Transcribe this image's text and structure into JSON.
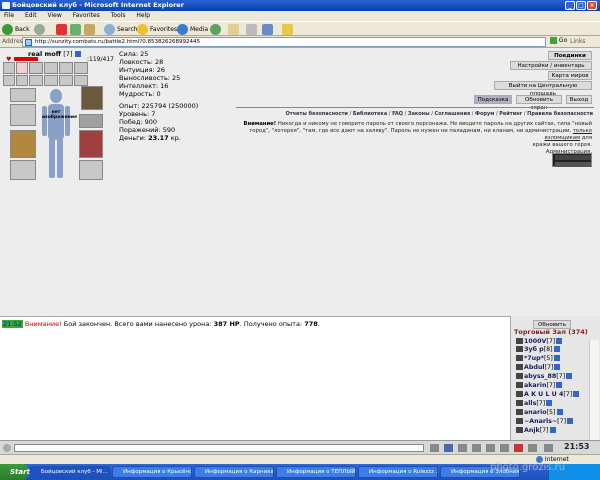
{
  "window": {
    "title": "Бойцовский клуб - Microsoft Internet Explorer"
  },
  "menu": [
    "File",
    "Edit",
    "View",
    "Favorites",
    "Tools",
    "Help"
  ],
  "toolbar": {
    "back": "Back",
    "search": "Search",
    "favorites": "Favorites",
    "media": "Media"
  },
  "address": {
    "label": "Address",
    "url": "http://sunzity.combats.ru/battle2.html?0.853826268992445",
    "go": "Go",
    "links": "Links"
  },
  "character": {
    "name": "real moff",
    "level": "[7]",
    "hp": ":119/417"
  },
  "stats": {
    "strength": "Сила: 25",
    "agility": "Ловкость: 28",
    "intuition": "Интуиция: 26",
    "endurance": "Выносливость: 25",
    "intellect": "Интеллект: 16",
    "wisdom": "Мудрость: 0"
  },
  "stats2": {
    "exp": "Опыт: 225794 (250000)",
    "level": "Уровень: 7",
    "wins": "Побед: 900",
    "losses": "Поражений: 590",
    "money_label": "Деньги:",
    "money_value": "23.17",
    "money_unit": "кр."
  },
  "slot_label": "нет изображения",
  "buttons": {
    "victory": "Поединки",
    "settings": "Настройки / инвентарь",
    "map": "Карта миров",
    "exit": "Выйти на Центральную площадь",
    "hint": "Подсказка",
    "refresh_screen": "Обновить экран",
    "logout": "Выход"
  },
  "navlinks": [
    "Отчеты безопасности",
    "Библиотека",
    "FAQ",
    "Законы",
    "Соглашения",
    "Форум",
    "Рейтинг",
    "Правила безопасности"
  ],
  "warning": {
    "lead": "Внимание!",
    "text1": "Никогда и никому не говорите пароль от своего персонажа. Не вводите пароль на других сайтах, типа \"новый город\",",
    "text2": "\"лотерея\", \"там, где все дают на халяву\". Пароль не нужен ни паладинам, ни кланам, ни администрации,",
    "link": "только взломщикам",
    "text3": "для",
    "text4": "кражи вашего героя.",
    "sign": "Администрация."
  },
  "chat": {
    "time": "21:52",
    "warn": "Внимание!",
    "msg1": "Бой закончен. Всего вами нанесено урона:",
    "dmg": "387 HP",
    "msg2": ". Получено опыта:",
    "exp": "778",
    "end": "."
  },
  "room": {
    "refresh": "Обновить",
    "title": "Торговый Зал (374)"
  },
  "users": [
    {
      "name": "1000V",
      "lv": "[7]"
    },
    {
      "name": "Зуб р",
      "lv": "[8]"
    },
    {
      "name": "*7up*",
      "lv": "[5]"
    },
    {
      "name": "Abdul",
      "lv": "[7]"
    },
    {
      "name": "abyss_88",
      "lv": "[7]"
    },
    {
      "name": "akarin",
      "lv": "[7]"
    },
    {
      "name": "A K U L U 4",
      "lv": "[7]"
    },
    {
      "name": "alls",
      "lv": "[7]"
    },
    {
      "name": "anario",
      "lv": "[5]"
    },
    {
      "name": "~Anarls~",
      "lv": "[7]"
    },
    {
      "name": "Anjk",
      "lv": "[7]"
    }
  ],
  "clock": "21:53",
  "status": {
    "zone": "Internet"
  },
  "taskbar": {
    "start": "Start",
    "tasks": [
      "Бойцовский клуб - Mi...",
      "Информация о Крысёно...",
      "Информация о Карника...",
      "Информация о ТЕПЛЫЙ ...",
      "Информация о Rulezzz ...",
      "Информация о Злобная ..."
    ]
  },
  "watermark": "photo.grozis.ru"
}
